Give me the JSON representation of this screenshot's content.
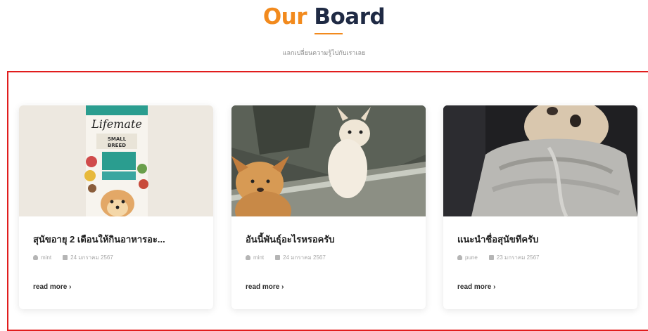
{
  "section": {
    "title_accent": "Our",
    "title_main": "Board",
    "subtitle": "แลกเปลี่ยนความรู้ไปกับเราเลย"
  },
  "posts": [
    {
      "title": "สุนัขอายุ 2 เดือนให้กินอาหารอะ...",
      "author": "mint",
      "date": "24 มกราคม 2567",
      "read_more": "read more ›",
      "image_icon": "dog-food-bag-image"
    },
    {
      "title": "อันนี้พันธุ์อะไรหรอครับ",
      "author": "mint",
      "date": "24 มกราคม 2567",
      "read_more": "read more ›",
      "image_icon": "two-chihuahuas-in-car-image"
    },
    {
      "title": "แนะนำชื่อสุนัขทีครับ",
      "author": "pune",
      "date": "23 มกราคม 2567",
      "read_more": "read more ›",
      "image_icon": "dog-in-towel-image"
    }
  ],
  "colors": {
    "accent": "#f28a1d",
    "title": "#1f2a44",
    "frame": "#e11d1d"
  }
}
